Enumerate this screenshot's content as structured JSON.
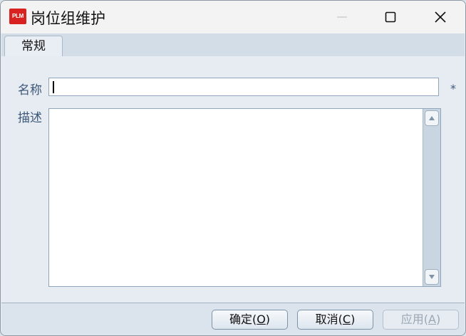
{
  "window": {
    "app_icon_text": "PLM",
    "title": "岗位组维护",
    "icons": {
      "minimize": "minimize-icon",
      "maximize": "maximize-icon",
      "close": "close-icon"
    }
  },
  "tabs": [
    {
      "label": "常规",
      "selected": true
    }
  ],
  "form": {
    "name_label": "名称",
    "name_value": "",
    "required_marker": "*",
    "description_label": "描述",
    "description_value": ""
  },
  "buttons": {
    "ok": {
      "text": "确定",
      "open": "(",
      "mnemonic": "O",
      "close": ")"
    },
    "cancel": {
      "text": "取消",
      "open": "(",
      "mnemonic": "C",
      "close": ")"
    },
    "apply": {
      "text": "应用",
      "open": "(",
      "mnemonic": "A",
      "close": ")",
      "disabled": true
    }
  },
  "colors": {
    "accent": "#d9221f",
    "label": "#3d5878"
  }
}
